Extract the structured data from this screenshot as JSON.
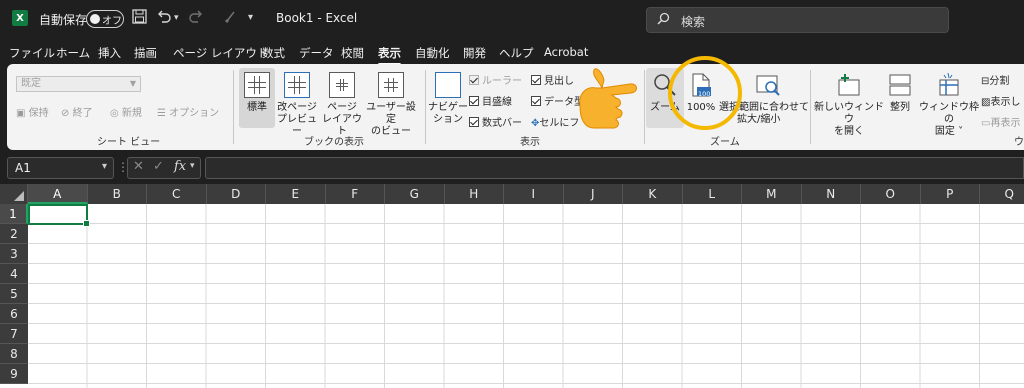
{
  "titlebar": {
    "app_logo": "X",
    "autosave_label": "自動保存",
    "autosave_state": "オフ",
    "document_title": "Book1  -  Excel",
    "search_placeholder": "検索",
    "icons": [
      "save-icon",
      "undo-icon",
      "redo-icon",
      "quick-access-dropdown-icon"
    ]
  },
  "menu": {
    "tabs": [
      "ファイル",
      "ホーム",
      "挿入",
      "描画",
      "ページ レイアウト",
      "数式",
      "データ",
      "校閲",
      "表示",
      "自動化",
      "開発",
      "ヘルプ",
      "Acrobat"
    ],
    "active": "表示"
  },
  "ribbon": {
    "sheet_view": {
      "label": "シート ビュー",
      "dropdown_value": "既定",
      "keep": "保持",
      "exit": "終了",
      "new": "新規",
      "options": "オプション"
    },
    "workbook_views": {
      "label": "ブックの表示",
      "normal": "標準",
      "page_break_line1": "改ページ",
      "page_break_line2": "プレビュー",
      "page_layout_line1": "ページ",
      "page_layout_line2": "レイアウト",
      "custom_line1": "ユーザー設定",
      "custom_line2": "のビュー"
    },
    "show": {
      "label": "表示",
      "navigation_line1": "ナビゲー",
      "navigation_line2": "ション",
      "ruler": "ルーラー",
      "gridlines": "目盛線",
      "formula_bar": "数式バー",
      "headings": "見出し",
      "data_type": "データ型",
      "focus_cell": "セルにフ"
    },
    "zoom": {
      "label": "ズーム",
      "zoom": "ズーム",
      "hundred": "100%",
      "selection": "選択",
      "fit_line1": "範囲に合わせて",
      "fit_line2": "拡大/縮小",
      "badge": "100"
    },
    "window": {
      "new_window_line1": "新しいウィンドウ",
      "new_window_line2": "を開く",
      "arrange": "整列",
      "freeze_line1": "ウィンドウ枠の",
      "freeze_line2": "固定",
      "split": "分割",
      "hide": "表示し",
      "unhide": "再表示",
      "label_partial": "ウ"
    }
  },
  "formula_bar": {
    "name_box": "A1",
    "fx": "fx"
  },
  "sheet": {
    "columns": [
      "A",
      "B",
      "C",
      "D",
      "E",
      "F",
      "G",
      "H",
      "I",
      "J",
      "K",
      "L",
      "M",
      "N",
      "O",
      "P",
      "Q"
    ],
    "rows": [
      "1",
      "2",
      "3",
      "4",
      "5",
      "6",
      "7",
      "8",
      "9"
    ],
    "active_cell": "A1"
  },
  "annotation": {
    "pointer": "pointing-hand",
    "highlight_color": "#f5b800"
  },
  "colors": {
    "excel_green": "#107c41",
    "dark_bg": "#1f1f1f",
    "ribbon_bg": "#f3f3f3"
  }
}
